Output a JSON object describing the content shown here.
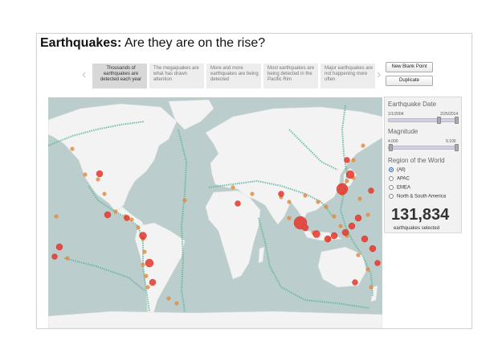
{
  "title": {
    "bold": "Earthquakes:",
    "rest": " Are they are on the rise?"
  },
  "story": {
    "prev_icon": "chevron-left-icon",
    "next_icon": "chevron-right-icon",
    "points": [
      {
        "text": "Thousands of earthquakes are detected each year",
        "active": true
      },
      {
        "text": "The megaquakes are what has drawn attention",
        "active": false
      },
      {
        "text": "More and more earthquakes are being detected",
        "active": false
      },
      {
        "text": "Most earthquakes are being detected in the Pacific Rim",
        "active": false
      },
      {
        "text": "Major earthquakes are not happening more often",
        "active": false
      }
    ],
    "new_blank_point": "New Blank Point",
    "duplicate": "Duplicate"
  },
  "filters": {
    "date": {
      "label": "Earthquake Date",
      "min": "1/1/2004",
      "max": "2/26/2014"
    },
    "magnitude": {
      "label": "Magnitude",
      "min": "4.000",
      "max": "9.100"
    },
    "region": {
      "label": "Region of the World",
      "options": [
        "(All)",
        "APAC",
        "EMEA",
        "North & South America"
      ],
      "selected": "(All)"
    }
  },
  "summary": {
    "count": "131,834",
    "caption": "earthquakes selected"
  },
  "colors": {
    "ocean": "#bccdcd",
    "land": "#f3f3f3",
    "plate_dots": "#5fb79a",
    "medium_quake": "#e28a3c",
    "large_quake": "#e8362b"
  }
}
